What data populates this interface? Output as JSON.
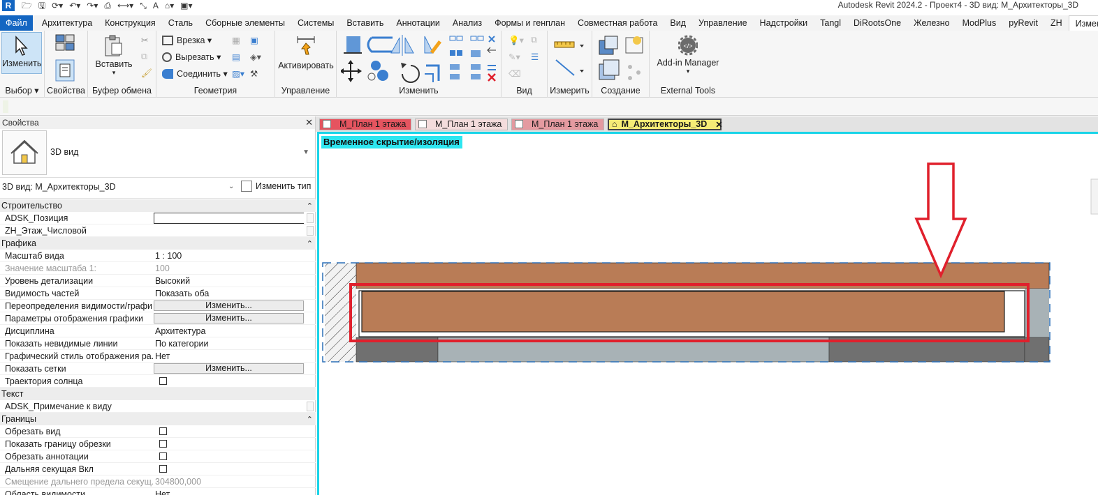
{
  "window": {
    "title": "Autodesk Revit 2024.2 - Проект4 - 3D вид: М_Архитекторы_3D",
    "logo": "R"
  },
  "quick_access": {
    "icons": [
      "folder-open-icon",
      "save-icon",
      "sync-icon",
      "undo-icon",
      "redo-icon",
      "print-icon",
      "measure-icon",
      "text-icon",
      "home-icon",
      "switch-windows-icon"
    ]
  },
  "ribbon_tabs": [
    {
      "label": "Файл"
    },
    {
      "label": "Архитектура"
    },
    {
      "label": "Конструкция"
    },
    {
      "label": "Сталь"
    },
    {
      "label": "Сборные элементы"
    },
    {
      "label": "Системы"
    },
    {
      "label": "Вставить"
    },
    {
      "label": "Аннотации"
    },
    {
      "label": "Анализ"
    },
    {
      "label": "Формы и генплан"
    },
    {
      "label": "Совместная работа"
    },
    {
      "label": "Вид"
    },
    {
      "label": "Управление"
    },
    {
      "label": "Надстройки"
    },
    {
      "label": "Tangl"
    },
    {
      "label": "DiRootsOne"
    },
    {
      "label": "Железно"
    },
    {
      "label": "ModPlus"
    },
    {
      "label": "pyRevit"
    },
    {
      "label": "ZH"
    },
    {
      "label": "Изменить"
    }
  ],
  "ribbon": {
    "select": {
      "button": "Изменить",
      "panel": "Выбор"
    },
    "properties": {
      "panel": "Свойства"
    },
    "clipboard": {
      "button": "Вставить",
      "panel": "Буфер обмена"
    },
    "geometry": {
      "cope": "Врезка",
      "cut": "Вырезать",
      "join": "Соединить",
      "panel": "Геометрия"
    },
    "control": {
      "button": "Активировать",
      "panel": "Управление"
    },
    "modify": {
      "panel": "Изменить"
    },
    "view": {
      "panel": "Вид"
    },
    "measure": {
      "panel": "Измерить"
    },
    "create": {
      "panel": "Создание"
    },
    "external": {
      "button": "Add-in Manager",
      "panel": "External Tools"
    }
  },
  "properties": {
    "title": "Свойства",
    "type_name": "3D вид",
    "instance": "3D вид: М_Архитекторы_3D",
    "edit_type": "Изменить тип",
    "sections": {
      "construction": {
        "title": "Строительство",
        "rows": [
          {
            "k": "ADSK_Позиция",
            "v": ""
          },
          {
            "k": "ZH_Этаж_Числовой",
            "v": ""
          }
        ]
      },
      "graphics": {
        "title": "Графика",
        "rows": [
          {
            "k": "Масштаб вида",
            "v": "1 : 100"
          },
          {
            "k": "Значение масштаба    1:",
            "v": "100"
          },
          {
            "k": "Уровень детализации",
            "v": "Высокий"
          },
          {
            "k": "Видимость частей",
            "v": "Показать оба"
          },
          {
            "k": "Переопределения видимости/графи...",
            "v": "Изменить..."
          },
          {
            "k": "Параметры отображения графики",
            "v": "Изменить..."
          },
          {
            "k": "Дисциплина",
            "v": "Архитектура"
          },
          {
            "k": "Показать невидимые линии",
            "v": "По категории"
          },
          {
            "k": "Графический стиль отображения ра...",
            "v": "Нет"
          },
          {
            "k": "Показать сетки",
            "v": "Изменить..."
          },
          {
            "k": "Траектория солнца",
            "v": ""
          }
        ]
      },
      "text": {
        "title": "Текст",
        "rows": [
          {
            "k": "ADSK_Примечание к виду",
            "v": ""
          }
        ]
      },
      "extents": {
        "title": "Границы",
        "rows": [
          {
            "k": "Обрезать вид",
            "v": ""
          },
          {
            "k": "Показать границу обрезки",
            "v": ""
          },
          {
            "k": "Обрезать аннотации",
            "v": ""
          },
          {
            "k": "Дальняя секущая Вкл",
            "v": ""
          },
          {
            "k": "Смещение дальнего предела секущ...",
            "v": "304800,000"
          },
          {
            "k": "Область видимости",
            "v": "Нет"
          }
        ]
      }
    }
  },
  "view_tabs": [
    {
      "label": "М_План 1 этажа"
    },
    {
      "label": "М_План 1 этажа"
    },
    {
      "label": "М_План 1 этажа"
    },
    {
      "label": "М_Архитекторы_3D"
    }
  ],
  "view": {
    "isolate_label": "Временное скрытие/изоляция"
  },
  "colors": {
    "revit_blue": "#1466c2",
    "isolate_cyan": "#2ee6f0",
    "highlight_red": "#e0202c",
    "wall_brown": "#b97c56"
  }
}
